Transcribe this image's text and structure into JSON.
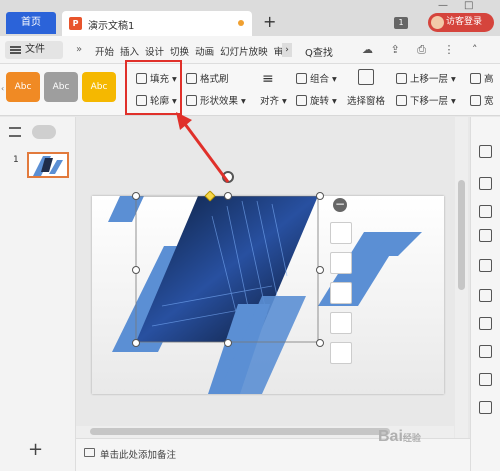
{
  "titlebar": {
    "home_tab": "首页",
    "doc_tab": "演示文稿1",
    "add_tab": "+",
    "page_badge": "1",
    "login_label": "访客登录",
    "win_min": "—",
    "win_max": "□"
  },
  "menubar": {
    "file_label": "文件",
    "expand": "»",
    "items": [
      "开始",
      "插入",
      "设计",
      "切换",
      "动画",
      "幻灯片放映",
      "审阅"
    ],
    "more": "›",
    "search_label": "Q查找"
  },
  "ribbon": {
    "styles": [
      {
        "label": "Abc",
        "color": "#f08a24"
      },
      {
        "label": "Abc",
        "color": "#9e9e9e"
      },
      {
        "label": "Abc",
        "color": "#f5b800"
      }
    ],
    "fill_label": "填充",
    "outline_label": "轮廓",
    "format_painter_label": "格式刷",
    "shape_effect_label": "形状效果",
    "align_label": "对齐",
    "group_label": "组合",
    "rotate_label": "旋转",
    "selection_pane_label": "选择窗格",
    "bring_forward_label": "上移一层",
    "send_backward_label": "下移一层",
    "high_label": "高",
    "width_label": "宽"
  },
  "leftpanel": {
    "slide_number": "1",
    "add_label": "+"
  },
  "notes": {
    "placeholder": "单击此处添加备注"
  },
  "watermark": {
    "text": "Bai",
    "suffix": "经验"
  },
  "colors": {
    "accent": "#2b63d9",
    "shape_blue": "#5b8fd4",
    "highlight_red": "#e0302a",
    "tab_orange": "#e8542c"
  }
}
